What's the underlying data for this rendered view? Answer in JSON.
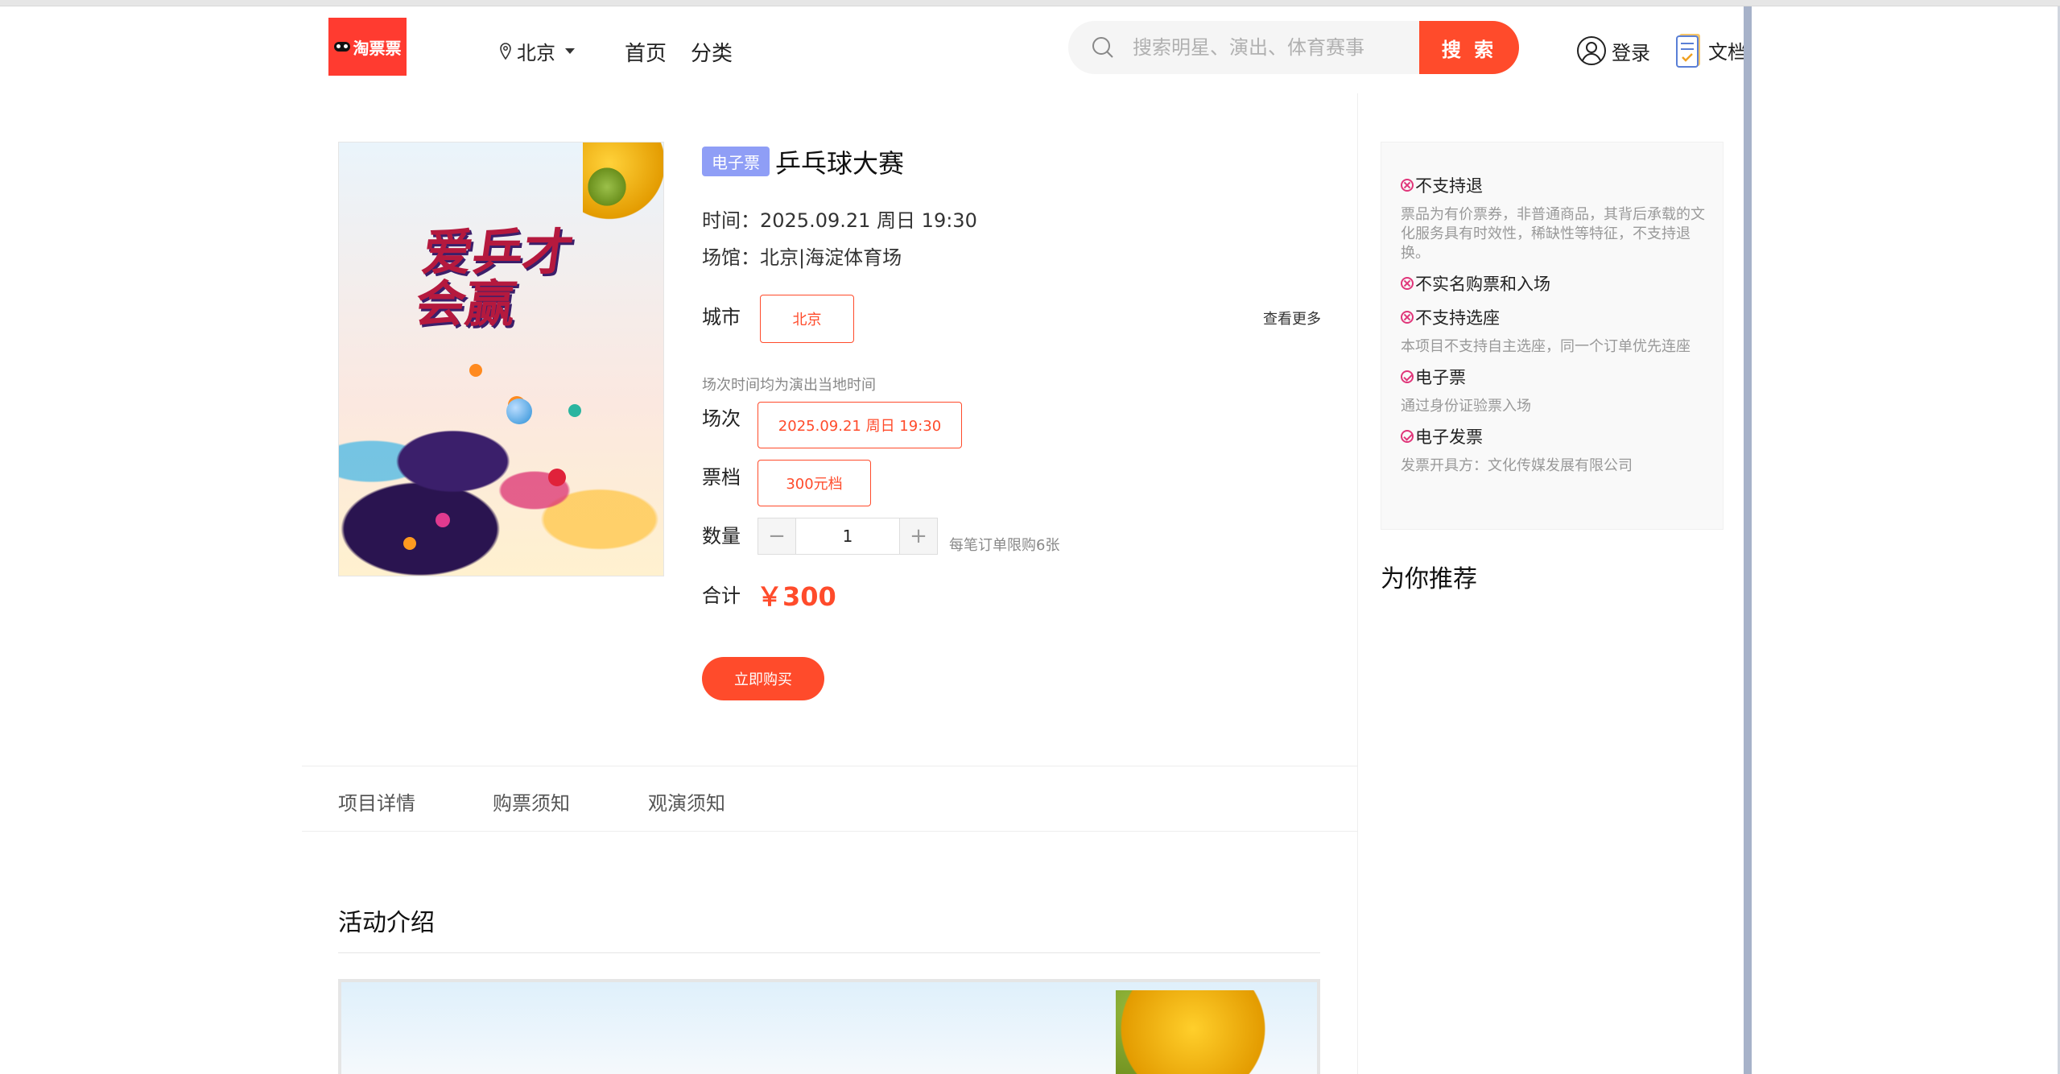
{
  "header": {
    "logo_text": "淘票票",
    "city": "北京",
    "nav": [
      "首页",
      "分类"
    ],
    "search_placeholder": "搜索明星、演出、体育赛事",
    "search_button": "搜 索",
    "login": "登录",
    "docs": "文档"
  },
  "event": {
    "badge": "电子票",
    "title": "乒乓球大赛",
    "time": "时间：2025.09.21 周日 19:30",
    "venue": "场馆：北京|海淀体育场",
    "poster_title": "爱乒才会赢",
    "city_label": "城市",
    "city_option": "北京",
    "see_more": "查看更多",
    "time_note": "场次时间均为演出当地时间",
    "session_label": "场次",
    "session_option": "2025.09.21 周日 19:30",
    "tier_label": "票档",
    "tier_option": "300元档",
    "qty_label": "数量",
    "qty_minus": "−",
    "qty_value": "1",
    "qty_plus": "+",
    "qty_limit": "每笔订单限购6张",
    "total_label": "合计",
    "total_value": "￥300",
    "buy_button": "立即购买"
  },
  "tabs": [
    "项目详情",
    "购票须知",
    "观演须知"
  ],
  "section_title": "活动介绍",
  "rules": [
    {
      "icon": "x-circle-icon",
      "title": "不支持退",
      "desc": "票品为有价票券，非普通商品，其背后承载的文化服务具有时效性，稀缺性等特征，不支持退换。"
    },
    {
      "icon": "x-circle-icon",
      "title": "不实名购票和入场",
      "desc": ""
    },
    {
      "icon": "x-circle-icon",
      "title": "不支持选座",
      "desc": "本项目不支持自主选座，同一个订单优先连座"
    },
    {
      "icon": "check-circle-icon",
      "title": "电子票",
      "desc": "通过身份证验票入场"
    },
    {
      "icon": "check-circle-icon",
      "title": "电子发票",
      "desc": "发票开具方：文化传媒发展有限公司"
    }
  ],
  "recommend_title": "为你推荐",
  "colors": {
    "accent": "#ff4b2b",
    "badge": "#8f9ef6",
    "rule_icon": "#e0367a"
  }
}
